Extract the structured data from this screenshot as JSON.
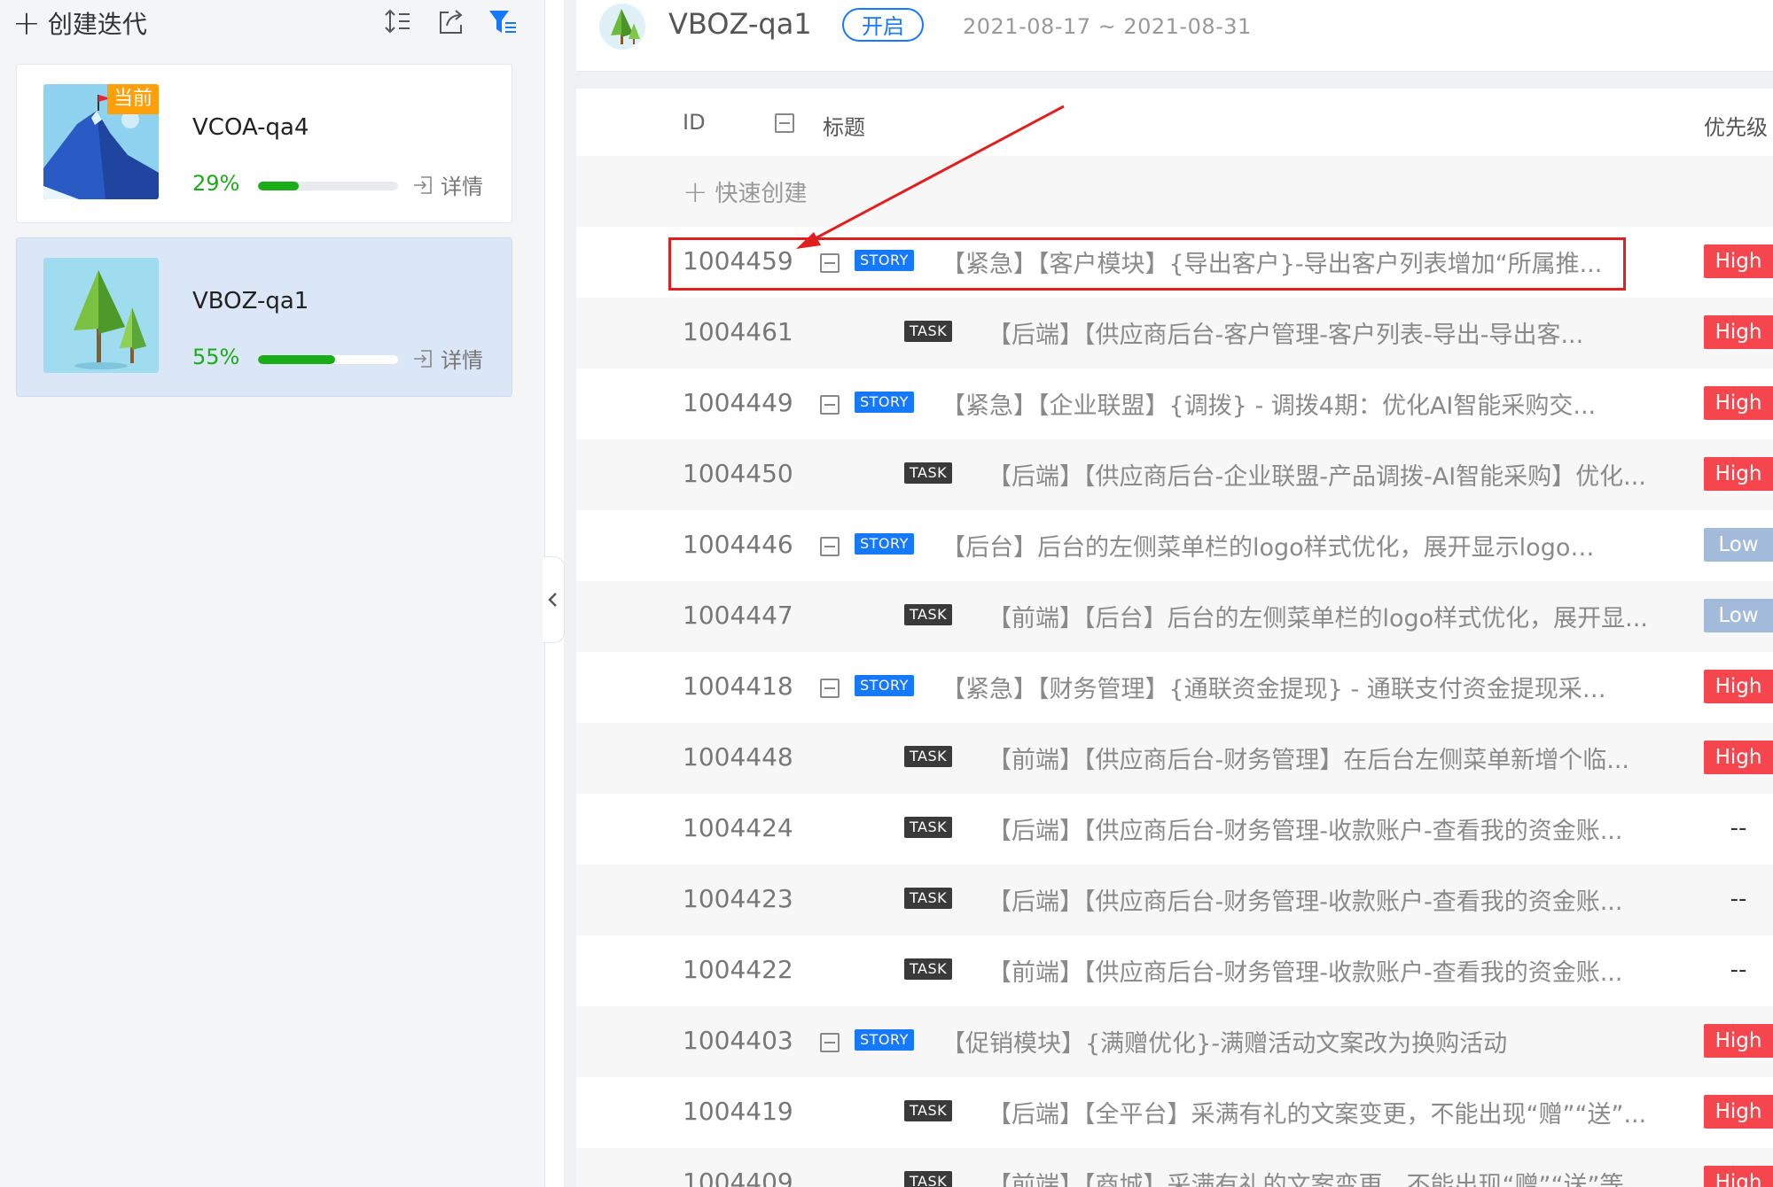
{
  "sidebar": {
    "create_label": "创建迭代",
    "iterations": [
      {
        "name": "VCOA-qa4",
        "percent_label": "29%",
        "progress": 0.29,
        "badge": "当前",
        "detail_label": "详情"
      },
      {
        "name": "VBOZ-qa1",
        "percent_label": "55%",
        "progress": 0.55,
        "badge": "",
        "detail_label": "详情"
      }
    ]
  },
  "header": {
    "title": "VBOZ-qa1",
    "status": "开启",
    "dates": "2021-08-17 ~ 2021-08-31"
  },
  "table": {
    "columns": {
      "id": "ID",
      "title": "标题",
      "priority": "优先级"
    },
    "quick_create_label": "快速创建",
    "rows": [
      {
        "id": "1004459",
        "type": "STORY",
        "title": "【紧急】【客户模块】{导出客户}-导出客户列表增加“所属推...",
        "priority": "High"
      },
      {
        "id": "1004461",
        "type": "TASK",
        "title": "【后端】【供应商后台-客户管理-客户列表-导出-导出客...",
        "priority": "High"
      },
      {
        "id": "1004449",
        "type": "STORY",
        "title": "【紧急】【企业联盟】{调拨} - 调拨4期：优化AI智能采购交...",
        "priority": "High"
      },
      {
        "id": "1004450",
        "type": "TASK",
        "title": "【后端】【供应商后台-企业联盟-产品调拨-AI智能采购】优化...",
        "priority": "High"
      },
      {
        "id": "1004446",
        "type": "STORY",
        "title": "【后台】后台的左侧菜单栏的logo样式优化，展开显示logo，折...",
        "priority": "Low"
      },
      {
        "id": "1004447",
        "type": "TASK",
        "title": "【前端】【后台】后台的左侧菜单栏的logo样式优化，展开显...",
        "priority": "Low"
      },
      {
        "id": "1004418",
        "type": "STORY",
        "title": "【紧急】【财务管理】{通联资金提现} - 通联支付资金提现采用页...",
        "priority": "High"
      },
      {
        "id": "1004448",
        "type": "TASK",
        "title": "【前端】【供应商后台-财务管理】在后台左侧菜单新增个临...",
        "priority": "High"
      },
      {
        "id": "1004424",
        "type": "TASK",
        "title": "【后端】【供应商后台-财务管理-收款账户-查看我的资金账...",
        "priority": "--"
      },
      {
        "id": "1004423",
        "type": "TASK",
        "title": "【后端】【供应商后台-财务管理-收款账户-查看我的资金账...",
        "priority": "--"
      },
      {
        "id": "1004422",
        "type": "TASK",
        "title": "【前端】【供应商后台-财务管理-收款账户-查看我的资金账...",
        "priority": "--"
      },
      {
        "id": "1004403",
        "type": "STORY",
        "title": "【促销模块】{满赠优化}-满赠活动文案改为换购活动",
        "priority": "High"
      },
      {
        "id": "1004419",
        "type": "TASK",
        "title": "【后端】【全平台】采满有礼的文案变更，不能出现“赠”“送”...",
        "priority": "High"
      },
      {
        "id": "1004409",
        "type": "TASK",
        "title": "【前端】【商城】采满有礼的文案变更，不能出现“赠”“送”等...",
        "priority": "High"
      }
    ]
  },
  "colors": {
    "accent": "#1677ff",
    "progress": "#1aad19",
    "high": "#f5454d",
    "low": "#a3bbdb",
    "annotation": "#e02020"
  }
}
